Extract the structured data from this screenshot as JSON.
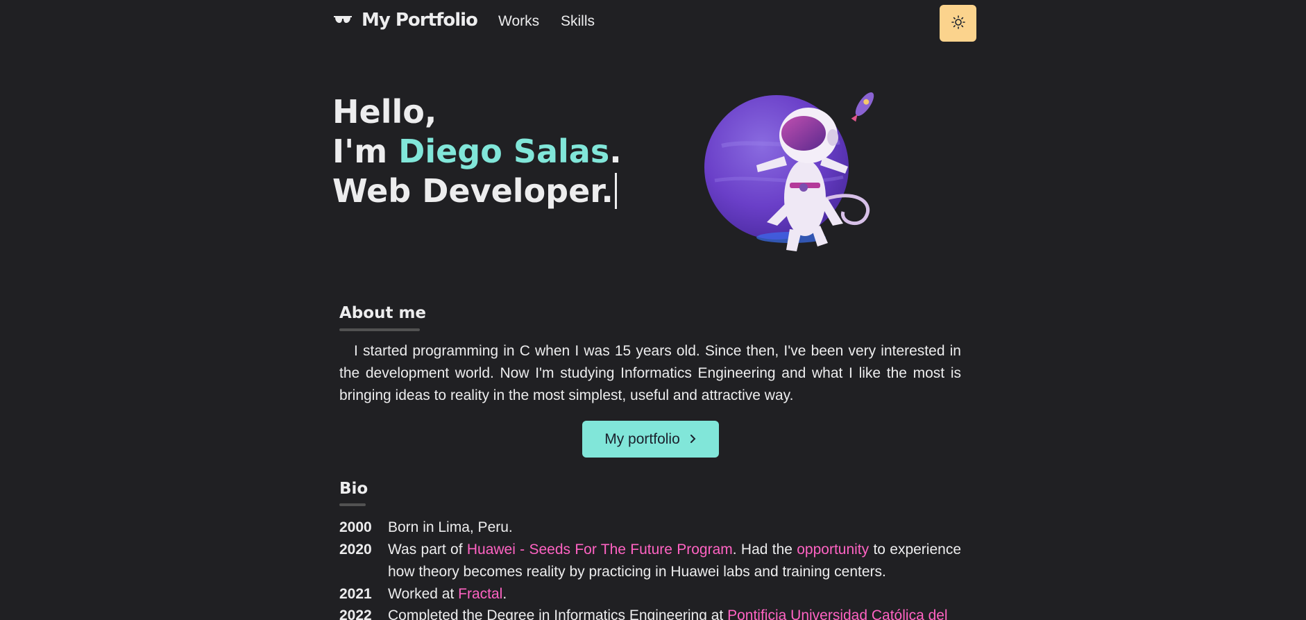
{
  "nav": {
    "logo_text": "My Portfolio",
    "links": [
      "Works",
      "Skills"
    ]
  },
  "hero": {
    "line1": "Hello,",
    "line2_prefix": "I'm ",
    "name": "Diego Salas",
    "line2_suffix": ".",
    "line3": "Web Developer."
  },
  "about": {
    "title": "About me",
    "text": "I started programming in C when I was 15 years old. Since then, I've been very interested in the development world. Now I'm studying Informatics Engineering and what I like the most is bringing ideas to reality in the most simplest, useful and attractive way.",
    "button_label": "My portfolio"
  },
  "bio": {
    "title": "Bio",
    "entries": [
      {
        "year": "2000",
        "text": "Born in Lima, Peru."
      },
      {
        "year": "2020",
        "pre": "Was part of ",
        "link1": "Huawei - Seeds For The Future Program",
        "mid": ". Had the ",
        "link2": "opportunity",
        "post": " to experience how theory becomes reality by practicing in Huawei labs and training centers."
      },
      {
        "year": "2021",
        "pre": "Worked at ",
        "link1": "Fractal",
        "post": "."
      },
      {
        "year": "2022",
        "pre": "Completed the Degree in Informatics Engineering at ",
        "link1": "Pontificia Universidad Católica del"
      }
    ]
  },
  "colors": {
    "background": "#202023",
    "accent": "#81e6d9",
    "link": "#ff63c3",
    "theme_button": "#fbd38d"
  },
  "icons": {
    "logo": "sunglasses-icon",
    "theme": "sun-icon",
    "button": "chevron-right-icon"
  }
}
